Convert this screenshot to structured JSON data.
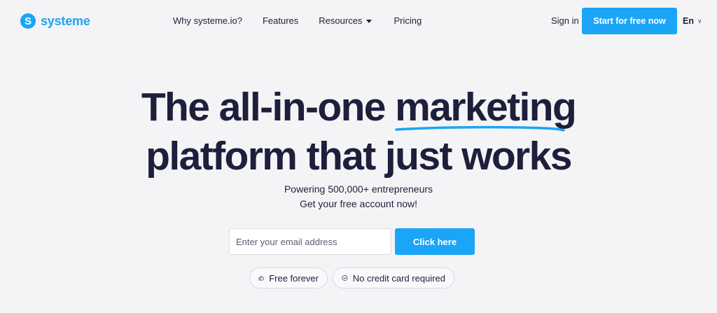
{
  "brand": {
    "logo_glyph": "S",
    "name": "systeme",
    "color": "#1aa5f7"
  },
  "nav": {
    "items": [
      {
        "label": "Why systeme.io?"
      },
      {
        "label": "Features"
      },
      {
        "label": "Resources",
        "icon": "caret-down-icon"
      },
      {
        "label": "Pricing"
      }
    ]
  },
  "header": {
    "signin_label": "Sign in",
    "cta_label": "Start for free now",
    "language": "En",
    "language_chevron": "∨"
  },
  "hero": {
    "headline_part1": "The all-in-one ",
    "headline_highlight": "marketing",
    "headline_line2": "platform that just works",
    "subtitle_line1": "Powering 500,000+ entrepreneurs",
    "subtitle_line2": "Get your free account now!",
    "underline_color": "#1aa5f7"
  },
  "signup": {
    "email_placeholder": "Enter your email address",
    "email_value": "",
    "button_label": "Click here"
  },
  "badges": [
    {
      "label": "Free forever",
      "icon": "thumbs-up-icon"
    },
    {
      "label": "No credit card required",
      "icon": "check-circle-icon"
    }
  ],
  "colors": {
    "accent": "#1aa5f7",
    "text": "#1d1f3b",
    "background": "#f4f4f6"
  }
}
